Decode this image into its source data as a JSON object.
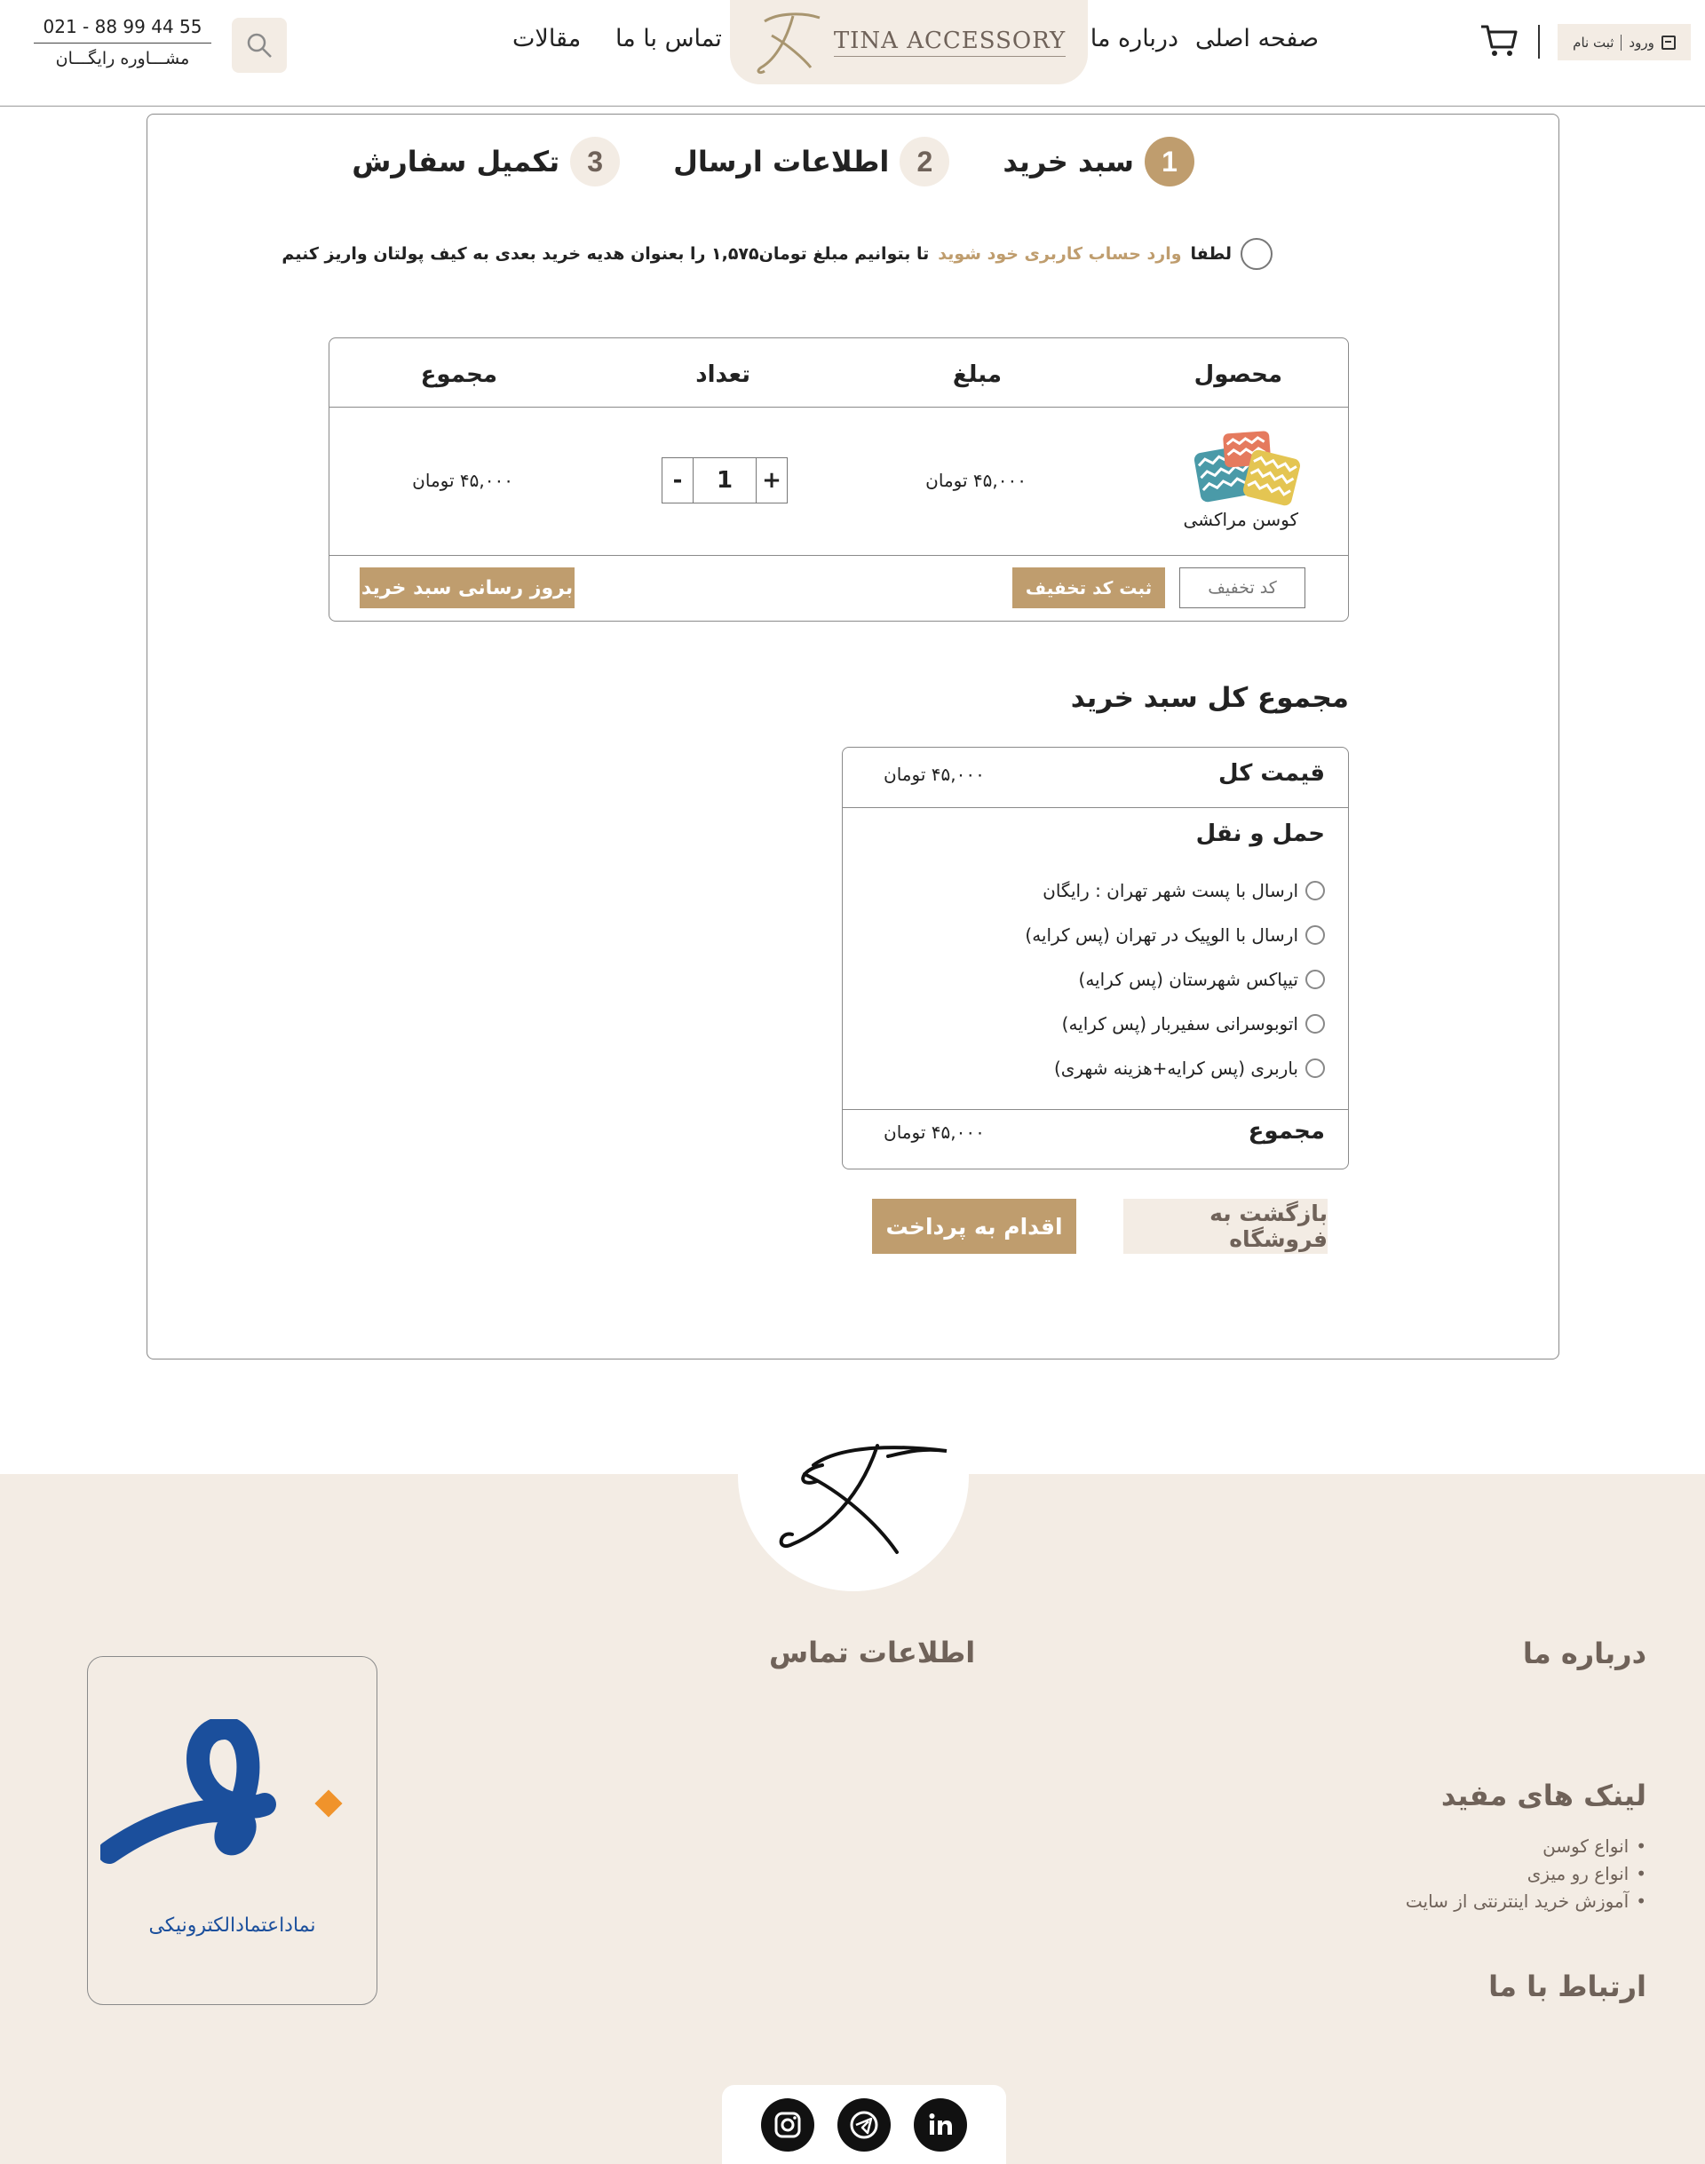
{
  "header": {
    "login_label": "ورود",
    "register_label": "ثبت نام",
    "nav_home": "صفحه اصلی",
    "nav_about": "درباره ما",
    "nav_contact": "تماس با ما",
    "nav_articles": "مقالات",
    "logo_text": "TINA ACCESSORY",
    "phone": "021 - 88 99 44 55",
    "consult": "مشـــاوره رایگـــان",
    "icons": [
      "cart-icon",
      "search-icon",
      "login-icon",
      "logo-monogram-icon"
    ]
  },
  "steps": [
    {
      "num": "1",
      "label": "سبد خرید",
      "active": true
    },
    {
      "num": "2",
      "label": "اطلاعات ارسال",
      "active": false
    },
    {
      "num": "3",
      "label": "تکمیل سفارش",
      "active": false
    }
  ],
  "promo": {
    "prefix": "لطفا",
    "link": "وارد حساب کاربری خود شوید",
    "suffix": "تا بتوانیم مبلغ تومان۱,۵۷۵ را بعنوان هدیه خرید بعدی به کیف پولتان واریز کنیم"
  },
  "cart": {
    "headers": {
      "product": "محصول",
      "price": "مبلغ",
      "qty": "تعداد",
      "total": "مجموع"
    },
    "items": [
      {
        "name": "کوسن مراکشی",
        "price": "۴۵,۰۰۰ تومان",
        "qty": "1",
        "total": "۴۵,۰۰۰ تومان"
      }
    ],
    "qty_minus": "-",
    "qty_plus": "+",
    "coupon_placeholder": "کد تخفیف",
    "coupon_button": "ثبت کد تخفیف",
    "update_button": "بروز رسانی سبد خرید"
  },
  "totals": {
    "title": "مجموع کل سبد خرید",
    "subtotal_label": "قیمت کل",
    "subtotal_value": "۴۵,۰۰۰ تومان",
    "shipping_label": "حمل و نقل",
    "shipping_options": [
      "ارسال با پست شهر تهران : رایگان",
      "ارسال با الوپیک در تهران (پس کرایه)",
      "تیپاکس شهرستان (پس کرایه)",
      "اتوبوسرانی سفیربار (پس کرایه)",
      "باربری (پس کرایه+هزینه شهری)"
    ],
    "total_label": "مجموع",
    "total_value": "۴۵,۰۰۰ تومان",
    "back_button": "بازگشت به فروشگاه",
    "pay_button": "اقدام به پرداخت"
  },
  "footer": {
    "about_heading": "درباره ما",
    "contact_heading": "اطلاعات تماس",
    "links_heading": "لینک های مفید",
    "links": [
      "انواع کوسن",
      "انواع رو میزی",
      "آموزش خرید اینترنتی از سایت"
    ],
    "connect_heading": "ارتباط با ما",
    "enamad_text": "نماداعتمادالکترونیکی",
    "social": [
      "instagram-icon",
      "telegram-icon",
      "linkedin-icon"
    ]
  },
  "colors": {
    "accent": "#bf9d6e",
    "beige": "#f3ece4",
    "muted_text": "#6f6259",
    "enamad_blue": "#1b4f9c",
    "enamad_orange": "#f0932b"
  }
}
